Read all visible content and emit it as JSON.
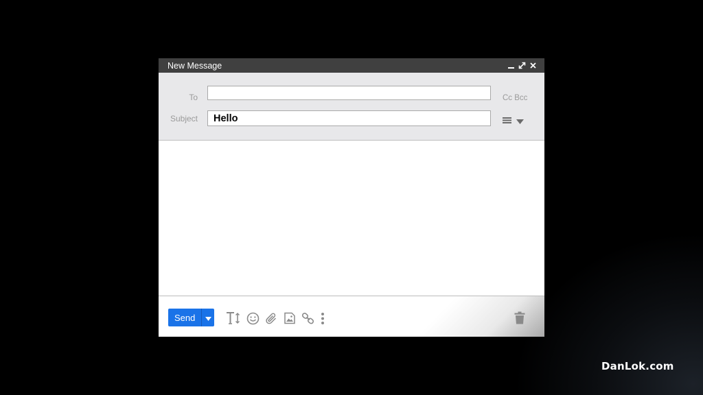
{
  "window": {
    "title": "New Message",
    "controls": [
      "minimize-icon",
      "expand-icon",
      "close-icon"
    ]
  },
  "header": {
    "to_label": "To",
    "to_value": "",
    "subject_label": "Subject",
    "subject_value": "Hello",
    "cc_label": "Cc",
    "bcc_label": "Bcc"
  },
  "footer": {
    "send_label": "Send",
    "tools": [
      "text-format-icon",
      "emoji-icon",
      "attach-icon",
      "image-icon",
      "link-icon",
      "more-options-icon"
    ],
    "trash": "trash-icon"
  },
  "colors": {
    "send_button": "#1a73e8",
    "titlebar": "#404040",
    "header_bg": "#e8e8ea"
  },
  "watermark": "DanLok.com"
}
